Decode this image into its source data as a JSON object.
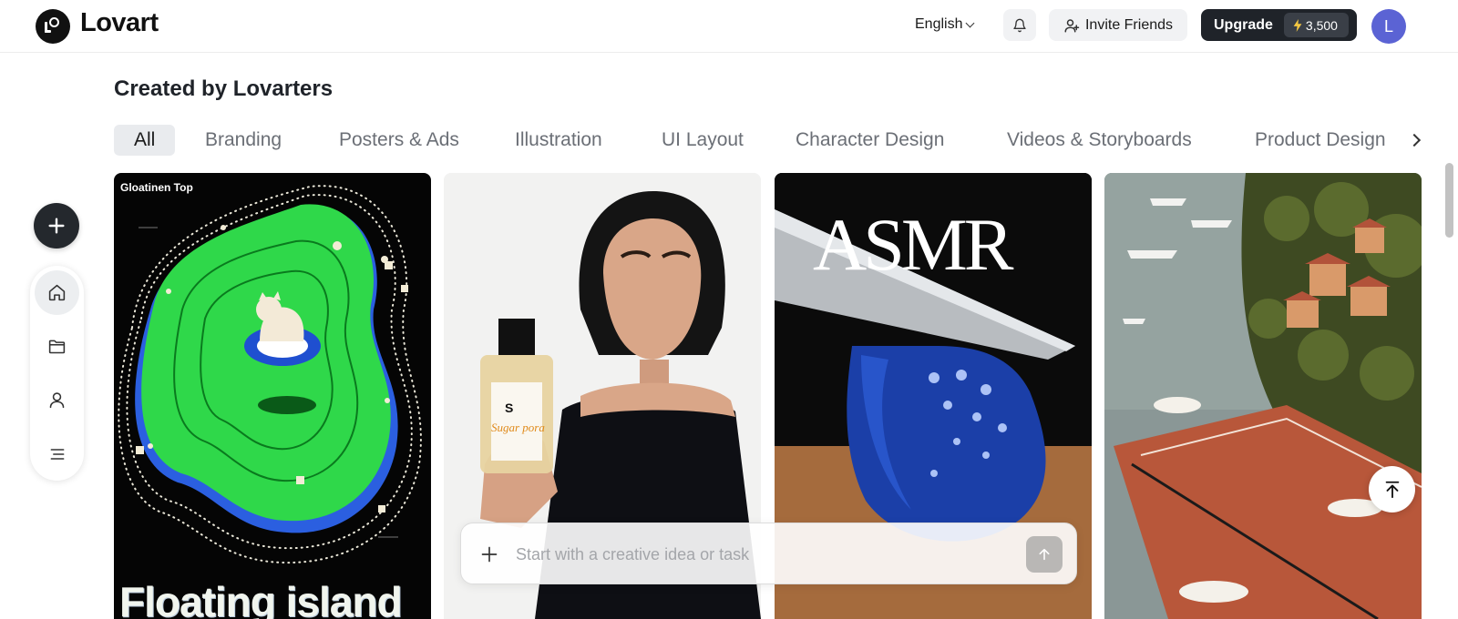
{
  "header": {
    "brand": "Lovart",
    "language": "English",
    "invite_label": "Invite Friends",
    "upgrade_label": "Upgrade",
    "credits": "3,500",
    "avatar_initial": "L"
  },
  "section": {
    "title": "Created by Lovarters"
  },
  "tabs": [
    {
      "label": "All",
      "active": true
    },
    {
      "label": "Branding",
      "active": false
    },
    {
      "label": "Posters & Ads",
      "active": false
    },
    {
      "label": "Illustration",
      "active": false
    },
    {
      "label": "UI Layout",
      "active": false
    },
    {
      "label": "Character Design",
      "active": false
    },
    {
      "label": "Videos & Storyboards",
      "active": false
    },
    {
      "label": "Product Design",
      "active": false
    }
  ],
  "rail": {
    "items": [
      "home-icon",
      "folder-icon",
      "user-icon",
      "menu-icon"
    ]
  },
  "gallery": {
    "cards": [
      {
        "label": "Gloatinen Top",
        "caption": "Floating island"
      },
      {
        "bottle_letter": "S",
        "bottle_brand": "Sugar pora"
      },
      {
        "caption": "ASMR"
      },
      {}
    ]
  },
  "prompt": {
    "placeholder": "Start with a creative idea or task"
  },
  "colors": {
    "accent_dark": "#1f2329",
    "avatar": "#5b63d4",
    "tab_active_bg": "#e9ebee"
  }
}
